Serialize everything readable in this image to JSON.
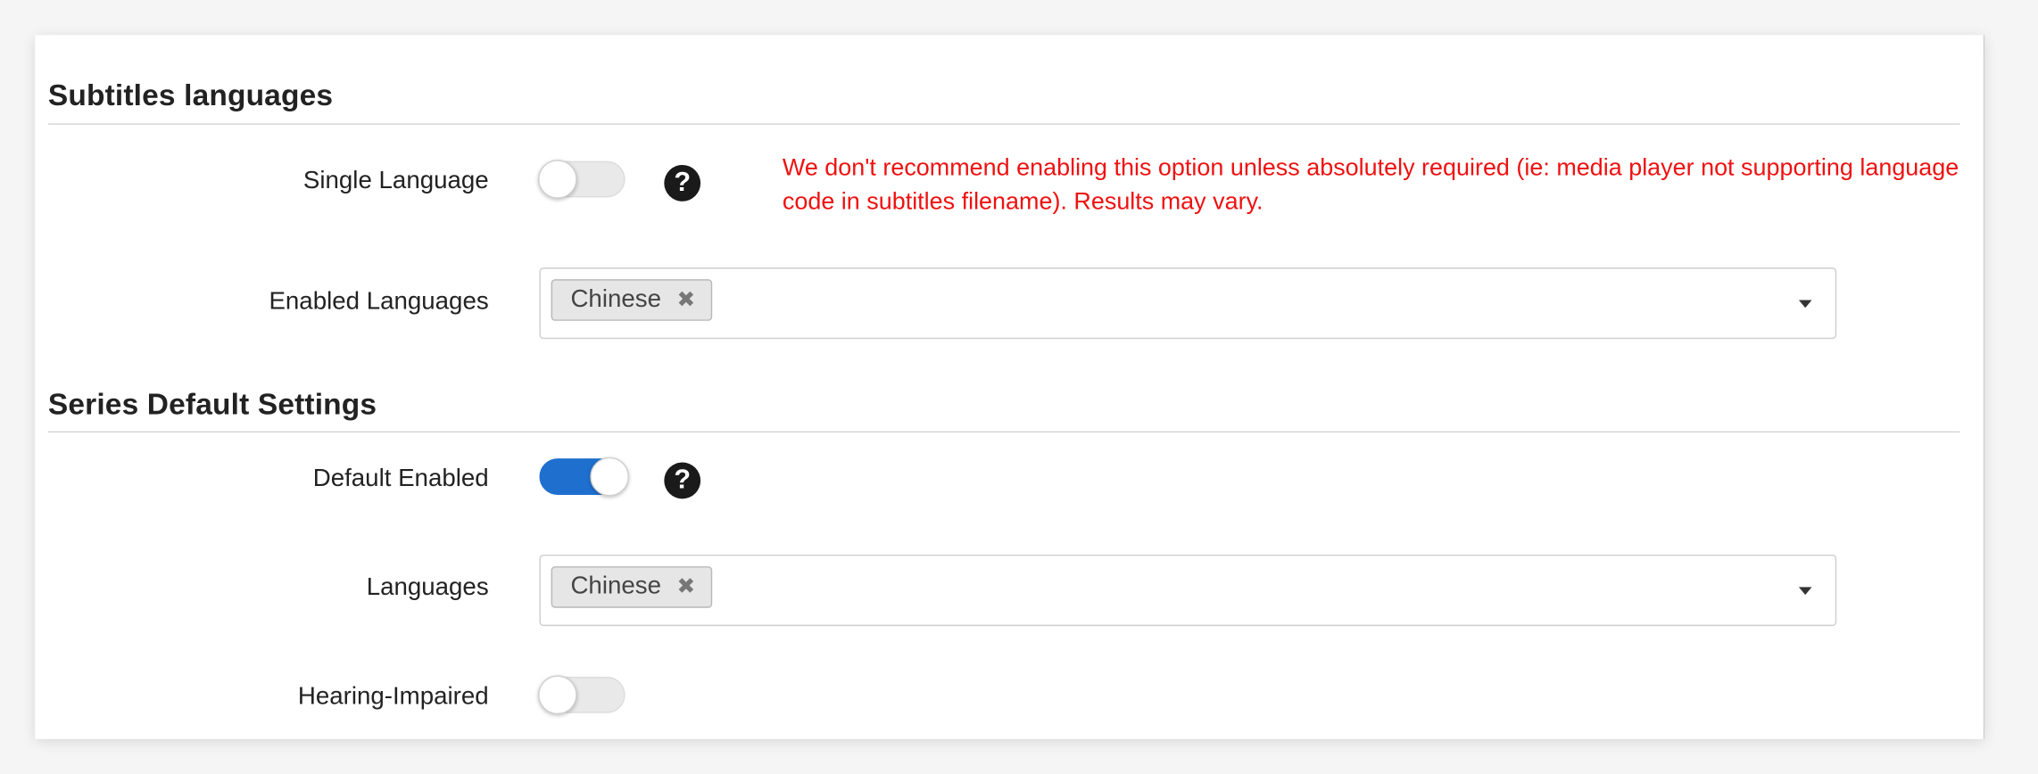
{
  "subtitles_section": {
    "title": "Subtitles languages",
    "single_language": {
      "label": "Single Language",
      "enabled": false,
      "help_glyph": "?",
      "warning": "We don't recommend enabling this option unless absolutely required (ie: media player not supporting language code in subtitles filename). Results may vary."
    },
    "enabled_languages": {
      "label": "Enabled Languages",
      "chips": [
        {
          "text": "Chinese",
          "remove_glyph": "✖"
        }
      ]
    }
  },
  "series_section": {
    "title": "Series Default Settings",
    "default_enabled": {
      "label": "Default Enabled",
      "enabled": true,
      "help_glyph": "?"
    },
    "languages": {
      "label": "Languages",
      "chips": [
        {
          "text": "Chinese",
          "remove_glyph": "✖"
        }
      ]
    },
    "hearing_impaired": {
      "label": "Hearing-Impaired",
      "enabled": false
    }
  },
  "colors": {
    "toggle_on": "#1f6fcf",
    "warning_text": "#ee1111",
    "help_icon": "#1a1a1a"
  },
  "icons": {
    "help": "question-circle-icon",
    "remove": "remove-x-icon",
    "dropdown": "caret-down-icon"
  }
}
